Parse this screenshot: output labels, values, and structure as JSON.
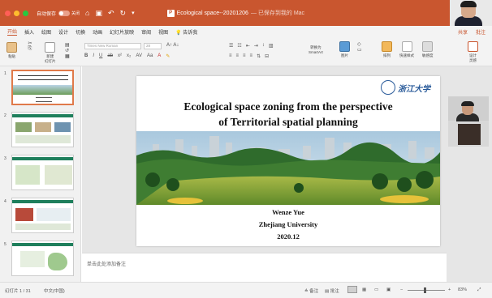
{
  "titlebar": {
    "autosave_label": "自动保存",
    "toggle_label": "关闭",
    "document_title": "Ecological space--20201206",
    "saved_status": "— 已保存到我的 Mac"
  },
  "tabs": [
    "开始",
    "插入",
    "绘图",
    "设计",
    "切换",
    "动画",
    "幻灯片放映",
    "审阅",
    "视图"
  ],
  "tell_me": "告诉我",
  "share_buttons": [
    "共享",
    "批注"
  ],
  "ribbon": {
    "paste": "粘贴",
    "new_slide": "新建\n幻灯片",
    "font_name": "Times New Roman",
    "font_size": "28",
    "convert_smartart": "转换为\nSmartArt",
    "picture": "图片",
    "arrange": "排列",
    "quick_styles": "快速样式",
    "sensitivity": "敏感度",
    "design_ideas": "设计\n灵感"
  },
  "slides": [
    {
      "number": "1"
    },
    {
      "number": "2"
    },
    {
      "number": "3"
    },
    {
      "number": "4"
    },
    {
      "number": "5"
    }
  ],
  "slide": {
    "title_line1": "Ecological space zoning from the perspective",
    "title_line2": "of Territorial spatial planning",
    "logo_text": "浙江大学",
    "author": "Wenze Yue",
    "affiliation": "Zhejiang University",
    "date": "2020.12"
  },
  "notes_placeholder": "单击此处添加备注",
  "status": {
    "slide_counter": "幻灯片 1 / 31",
    "language": "中文(中国)",
    "notes_btn": "备注",
    "comments_btn": "批注",
    "zoom": "83%"
  },
  "colors": {
    "accent": "#c9562f",
    "thumb_bar": "#1f7f5c",
    "logo": "#2a5b9a"
  }
}
